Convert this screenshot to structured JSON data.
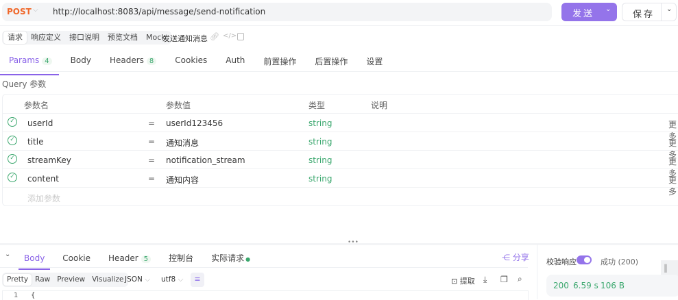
{
  "request": {
    "method": "POST",
    "url": "http://localhost:8083/api/message/send-notification",
    "send_label": "发送",
    "save_label": "保存"
  },
  "subtabs": [
    "请求",
    "响应定义",
    "接口说明",
    "预览文档",
    "Mock"
  ],
  "api_name": "发送通知消息",
  "tabs": [
    {
      "label": "Params",
      "count": "4"
    },
    {
      "label": "Body"
    },
    {
      "label": "Headers",
      "count": "8"
    },
    {
      "label": "Cookies"
    },
    {
      "label": "Auth"
    },
    {
      "label": "前置操作"
    },
    {
      "label": "后置操作"
    },
    {
      "label": "设置"
    }
  ],
  "query_label": "Query 参数",
  "params": {
    "headers": [
      "参数名",
      "参数值",
      "类型",
      "说明"
    ],
    "rows": [
      {
        "name": "userId",
        "value": "userId123456",
        "type": "string",
        "more": "更多"
      },
      {
        "name": "title",
        "value": "通知消息",
        "type": "string",
        "more": "更多"
      },
      {
        "name": "streamKey",
        "value": "notification_stream",
        "type": "string",
        "more": "更多"
      },
      {
        "name": "content",
        "value": "通知内容",
        "type": "string",
        "more": "更多"
      }
    ],
    "add_placeholder": "添加参数",
    "eq": "="
  },
  "response": {
    "tabs": [
      {
        "label": "Body"
      },
      {
        "label": "Cookie"
      },
      {
        "label": "Header",
        "count": "5"
      },
      {
        "label": "控制台"
      },
      {
        "label": "实际请求"
      }
    ],
    "share": "分享",
    "formats": [
      "Pretty",
      "Raw",
      "Preview",
      "Visualize"
    ],
    "lang": "JSON",
    "encoding": "utf8",
    "extract": "提取",
    "line_no": "1",
    "code": "{",
    "validate_label": "校验响应",
    "validate_on": true,
    "result": "成功 (200)",
    "status": "200",
    "time": "6.59 s",
    "size": "106 B"
  },
  "colors": {
    "accent": "#9474ea",
    "method": "#f0682b",
    "success": "#3aa76d"
  }
}
